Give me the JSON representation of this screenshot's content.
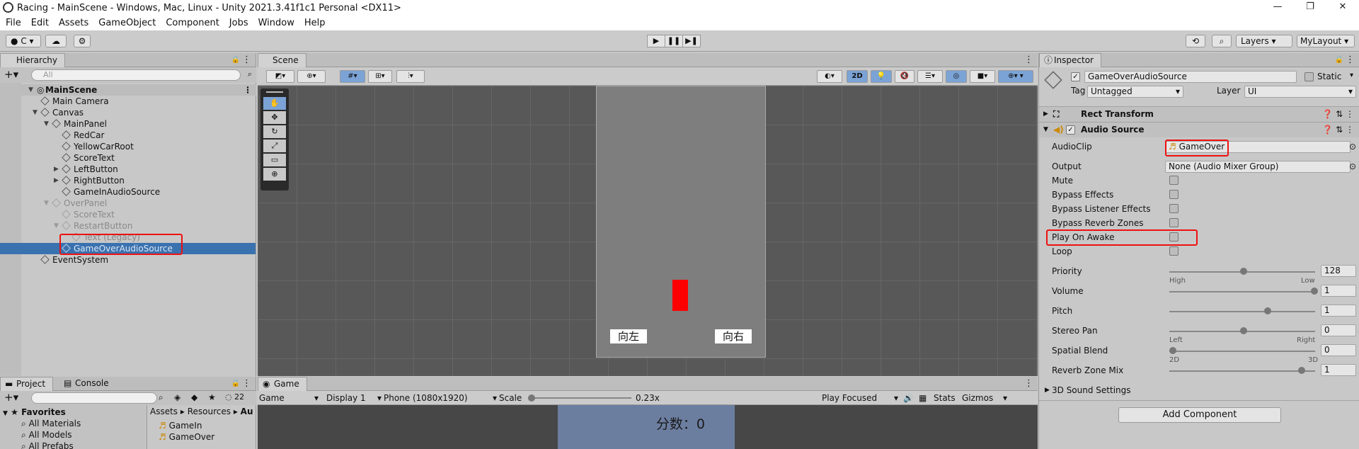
{
  "title": "Racing - MainScene - Windows, Mac, Linux - Unity 2021.3.41f1c1 Personal <DX11>",
  "window_controls": [
    "—",
    "❐",
    "✕"
  ],
  "menu": [
    "File",
    "Edit",
    "Assets",
    "GameObject",
    "Component",
    "Jobs",
    "Window",
    "Help"
  ],
  "toolbar": {
    "account": "C",
    "layers": "Layers",
    "layout": "MyLayout",
    "play": "▶",
    "pause": "❚❚",
    "step": "▶❚"
  },
  "hierarchy": {
    "tab": "Hierarchy",
    "search_placeholder": "All",
    "items": [
      {
        "label": "MainScene"
      },
      {
        "label": "Main Camera"
      },
      {
        "label": "Canvas"
      },
      {
        "label": "MainPanel"
      },
      {
        "label": "RedCar"
      },
      {
        "label": "YellowCarRoot"
      },
      {
        "label": "ScoreText"
      },
      {
        "label": "LeftButton"
      },
      {
        "label": "RightButton"
      },
      {
        "label": "GameInAudioSource"
      },
      {
        "label": "OverPanel"
      },
      {
        "label": "ScoreText"
      },
      {
        "label": "RestartButton"
      },
      {
        "label": "Text (Legacy)"
      },
      {
        "label": "GameOverAudioSource"
      },
      {
        "label": "EventSystem"
      }
    ]
  },
  "scene": {
    "tab": "Scene",
    "btn_2d": "2D",
    "left_button": "向左",
    "right_button": "向右"
  },
  "inspector": {
    "tab": "Inspector",
    "object_name": "GameOverAudioSource",
    "static_label": "Static",
    "tag_label": "Tag",
    "tag_value": "Untagged",
    "layer_label": "Layer",
    "layer_value": "UI",
    "rect_transform": "Rect Transform",
    "audio_source": "Audio Source",
    "audioclip_label": "AudioClip",
    "audioclip_value": "GameOver",
    "output_label": "Output",
    "output_value": "None (Audio Mixer Group)",
    "mute": "Mute",
    "bypass_effects": "Bypass Effects",
    "bypass_listener": "Bypass Listener Effects",
    "bypass_reverb": "Bypass Reverb Zones",
    "play_on_awake": "Play On Awake",
    "loop": "Loop",
    "priority_label": "Priority",
    "priority_value": "128",
    "priority_high": "High",
    "priority_low": "Low",
    "volume_label": "Volume",
    "volume_value": "1",
    "pitch_label": "Pitch",
    "pitch_value": "1",
    "stereo_label": "Stereo Pan",
    "stereo_value": "0",
    "stereo_left": "Left",
    "stereo_right": "Right",
    "spatial_label": "Spatial Blend",
    "spatial_value": "0",
    "spatial_2d": "2D",
    "spatial_3d": "3D",
    "reverb_label": "Reverb Zone Mix",
    "reverb_value": "1",
    "sound3d": "3D Sound Settings",
    "add_component": "Add Component"
  },
  "project": {
    "tab": "Project",
    "console_tab": "Console",
    "count": "22",
    "favorites": "Favorites",
    "fav_items": [
      "All Materials",
      "All Models",
      "All Prefabs"
    ],
    "breadcrumb": [
      "Assets",
      "Resources",
      "Au"
    ],
    "files": [
      "GameIn",
      "GameOver"
    ]
  },
  "game": {
    "tab": "Game",
    "display_mode": "Game",
    "display": "Display 1",
    "resolution": "Phone (1080x1920)",
    "scale_label": "Scale",
    "scale_value": "0.23x",
    "play_focused": "Play Focused",
    "stats": "Stats",
    "gizmos": "Gizmos",
    "score": "分数：0"
  },
  "colors": {
    "selection": "#3a72b0",
    "highlight": "#e11",
    "scene_bg": "#545454",
    "game_canvas": "#6c7ea0"
  }
}
